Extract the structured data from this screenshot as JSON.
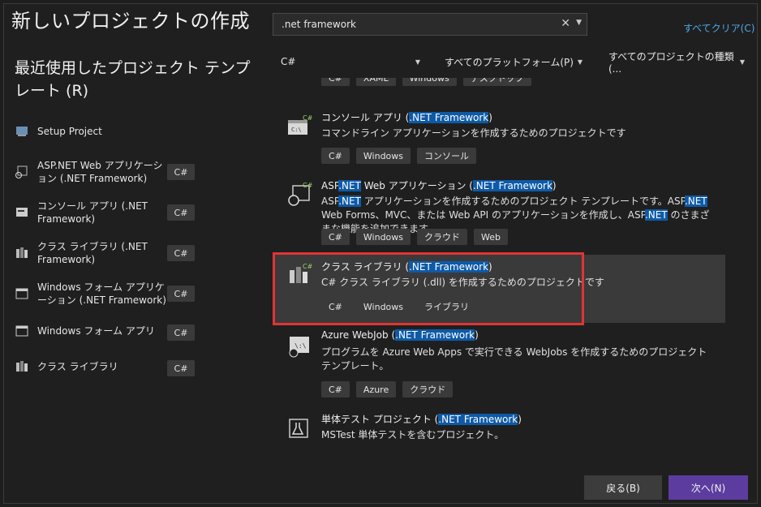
{
  "header": {
    "title": "新しいプロジェクトの作成"
  },
  "recent": {
    "title": "最近使用したプロジェクト テンプレート (R)",
    "items": [
      {
        "label": "Setup Project",
        "lang": "",
        "icon": "setup-project-icon"
      },
      {
        "label": "ASP.NET Web アプリケーション (.NET Framework)",
        "lang": "C#",
        "icon": "web-app-icon"
      },
      {
        "label": "コンソール アプリ (.NET Framework)",
        "lang": "C#",
        "icon": "console-app-icon"
      },
      {
        "label": "クラス ライブラリ (.NET Framework)",
        "lang": "C#",
        "icon": "class-library-icon"
      },
      {
        "label": "Windows フォーム アプリケーション (.NET Framework)",
        "lang": "C#",
        "icon": "windows-forms-icon"
      },
      {
        "label": "Windows フォーム アプリ",
        "lang": "C#",
        "icon": "windows-forms-icon"
      },
      {
        "label": "クラス ライブラリ",
        "lang": "C#",
        "icon": "class-library-icon"
      }
    ]
  },
  "search": {
    "value": ".net framework",
    "clear_all": "すべてクリア(C)"
  },
  "filters": {
    "language": "C#",
    "platform": "すべてのプラットフォーム(P)",
    "project_type": "すべてのプロジェクトの種類(..."
  },
  "results": {
    "partial_tags": [
      "C#",
      "XAML",
      "Windows",
      "デスクトップ"
    ],
    "items": [
      {
        "name_pre": "コンソール アプリ (",
        "name_hl": ".NET Framework",
        "name_post": ")",
        "desc": "コマンドライン アプリケーションを作成するためのプロジェクトです",
        "tags": [
          "C#",
          "Windows",
          "コンソール"
        ],
        "icon": "console-app-icon"
      },
      {
        "name_pre": "ASP",
        "name_hl": ".NET",
        "name_mid": " Web アプリケーション (",
        "name_hl2": ".NET Framework",
        "name_post": ")",
        "desc_parts": [
          "ASP",
          ".NET",
          " アプリケーションを作成するためのプロジェクト テンプレートです。ASP",
          ".NET",
          " Web Forms、MVC、または Web API のアプリケーションを作成し、ASP",
          ".NET",
          " のさまざまな機能を追加できます。"
        ],
        "tags": [
          "C#",
          "Windows",
          "クラウド",
          "Web"
        ],
        "icon": "web-app-icon"
      },
      {
        "name_pre": "クラス ライブラリ (",
        "name_hl": ".NET Framework",
        "name_post": ")",
        "desc": "C# クラス ライブラリ (.dll) を作成するためのプロジェクトです",
        "tags": [
          "C#",
          "Windows",
          "ライブラリ"
        ],
        "icon": "class-library-icon"
      },
      {
        "name_pre": "Azure WebJob (",
        "name_hl": ".NET Framework",
        "name_post": ")",
        "desc": "プログラムを Azure Web Apps で実行できる WebJobs を作成するためのプロジェクト テンプレート。",
        "tags": [
          "C#",
          "Azure",
          "クラウド"
        ],
        "icon": "azure-webjob-icon"
      },
      {
        "name_pre": "単体テスト プロジェクト (",
        "name_hl": ".NET Framework",
        "name_post": ")",
        "desc": "MSTest 単体テストを含むプロジェクト。",
        "tags": [],
        "icon": "unit-test-icon"
      }
    ]
  },
  "footer": {
    "back_label": "戻る(B)",
    "next_label": "次へ(N)"
  },
  "colors": {
    "accent": "#5c3d9f",
    "highlight": "#0e5aa7",
    "link": "#4aa8e8",
    "selection_box": "#e03434"
  }
}
